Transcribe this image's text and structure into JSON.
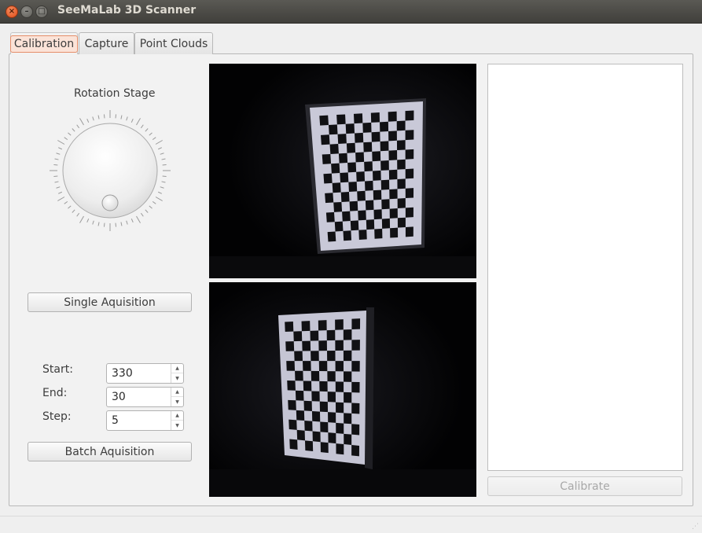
{
  "window": {
    "title": "SeeMaLab 3D Scanner",
    "controls": {
      "close": "×",
      "minimize": "–",
      "maximize": "□"
    }
  },
  "tabs": [
    {
      "label": "Calibration",
      "active": true
    },
    {
      "label": "Capture",
      "active": false
    },
    {
      "label": "Point Clouds",
      "active": false
    }
  ],
  "calibration": {
    "rotation_stage_label": "Rotation Stage",
    "single_acquisition_label": "Single Aquisition",
    "batch_acquisition_label": "Batch Aquisition",
    "fields": {
      "start": {
        "label": "Start:",
        "value": "330"
      },
      "end": {
        "label": "End:",
        "value": "30"
      },
      "step": {
        "label": "Step:",
        "value": "5"
      }
    },
    "calibrate_label": "Calibrate",
    "calibrate_enabled": false,
    "camera_views": [
      {
        "name": "camera-0-view",
        "content": "checkerboard calibration target"
      },
      {
        "name": "camera-1-view",
        "content": "checkerboard calibration target"
      }
    ],
    "dial_tick_count": 60
  },
  "icons": {
    "spin_up": "▲",
    "spin_down": "▼",
    "grip": "⋰"
  },
  "colors": {
    "titlebar": "#403f3b",
    "close_button": "#de4a16",
    "active_tab_highlight": "#e58e6a",
    "image_background": "#020203"
  }
}
